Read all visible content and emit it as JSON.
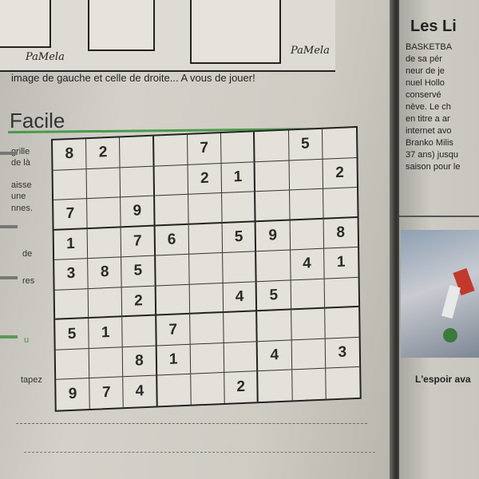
{
  "caption": "image de gauche et celle de droite... A vous de jouer!",
  "section_title": "Facile",
  "side_words": [
    "grille",
    "de là",
    "aisse",
    "une",
    "nnes.",
    "de",
    "res",
    "u",
    "tapez"
  ],
  "sudoku": {
    "rows": [
      [
        "8",
        "2",
        "",
        "",
        "7",
        "",
        "",
        "5",
        ""
      ],
      [
        "",
        "",
        "",
        "",
        "2",
        "1",
        "",
        "",
        "2"
      ],
      [
        "7",
        "",
        "9",
        "",
        "",
        "",
        "",
        "",
        ""
      ],
      [
        "1",
        "",
        "7",
        "6",
        "",
        "5",
        "9",
        "",
        "8"
      ],
      [
        "3",
        "8",
        "5",
        "",
        "",
        "",
        "",
        "4",
        "1"
      ],
      [
        "",
        "",
        "2",
        "",
        "",
        "4",
        "5",
        "",
        ""
      ],
      [
        "5",
        "1",
        "",
        "7",
        "",
        "",
        "",
        "",
        ""
      ],
      [
        "",
        "",
        "8",
        "1",
        "",
        "",
        "4",
        "",
        "3"
      ],
      [
        "9",
        "7",
        "4",
        "",
        "",
        "2",
        "",
        "",
        ""
      ]
    ]
  },
  "right_column": {
    "title": "Les Li",
    "text_lines": [
      "BASKETBA",
      "de sa pér",
      "neur de je",
      "nuel Hollo",
      "conservé",
      "nève. Le ch",
      "en titre a ar",
      "internet avo",
      "Branko Milis",
      "37 ans) jusqu",
      "saison pour le"
    ],
    "photo_caption": "L'espoir ava"
  },
  "comic_signature": "PaMela"
}
